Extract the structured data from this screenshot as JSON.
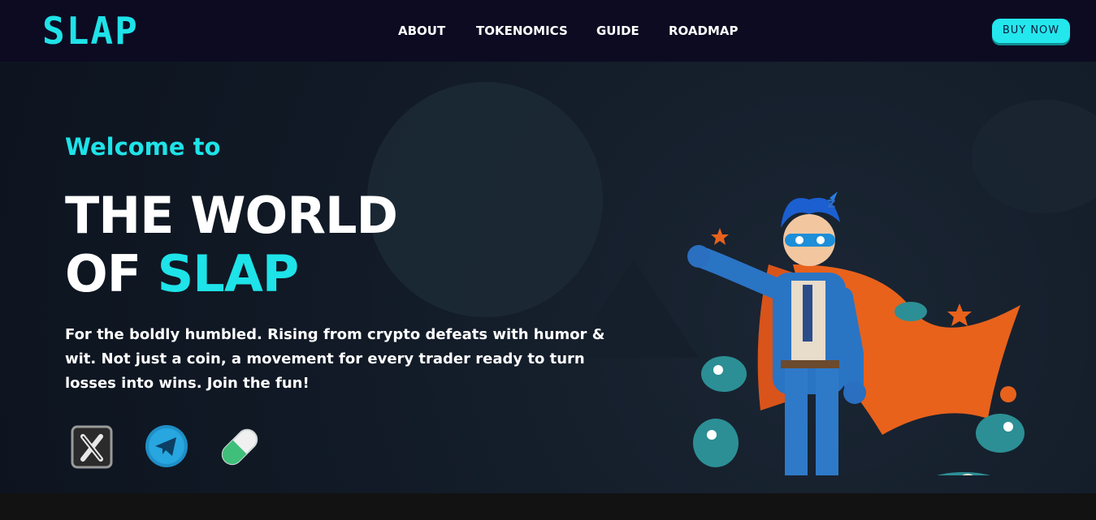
{
  "brand": {
    "logo_text": "SLAP"
  },
  "nav": {
    "items": [
      "ABOUT",
      "TOKENOMICS",
      "GUIDE",
      "ROADMAP"
    ]
  },
  "header": {
    "buy_label": "BUY NOW"
  },
  "hero": {
    "welcome": "Welcome to",
    "title_line1": "THE WORLD",
    "title_of": "OF ",
    "title_accent": "SLAP",
    "description": "For the boldly humbled. Rising from crypto defeats with humor & wit. Not just a coin, a movement for every trader ready to turn losses into wins. Join the fun!"
  },
  "social": [
    {
      "icon": "x-icon"
    },
    {
      "icon": "telegram-icon"
    },
    {
      "icon": "pill-icon"
    }
  ],
  "colors": {
    "accent": "#1ee3e8",
    "header_bg": "#0c0b22",
    "hero_bg": "#0d1420"
  }
}
